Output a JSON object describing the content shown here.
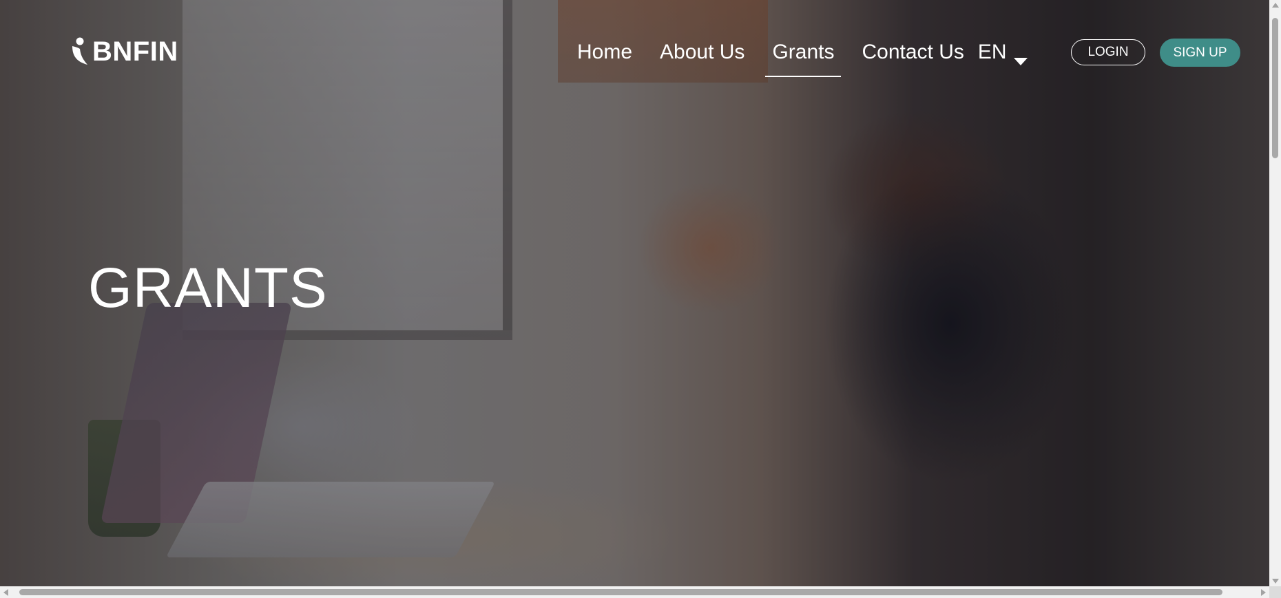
{
  "brand": {
    "logo_text": "BNFIN",
    "logo_icon": "person-leaf-icon"
  },
  "nav": {
    "items": [
      {
        "label": "Home",
        "active": false
      },
      {
        "label": "About Us",
        "active": false
      },
      {
        "label": "Grants",
        "active": true
      },
      {
        "label": "Contact Us",
        "active": false
      }
    ],
    "language": {
      "selected": "EN",
      "icon": "caret-down-icon"
    }
  },
  "auth": {
    "login_label": "LOGIN",
    "signup_label": "SIGN UP"
  },
  "hero": {
    "title": "GRANTS",
    "background_icon": "office-photo-background"
  },
  "colors": {
    "accent": "#3f8d88",
    "text_on_hero": "#ffffff"
  }
}
